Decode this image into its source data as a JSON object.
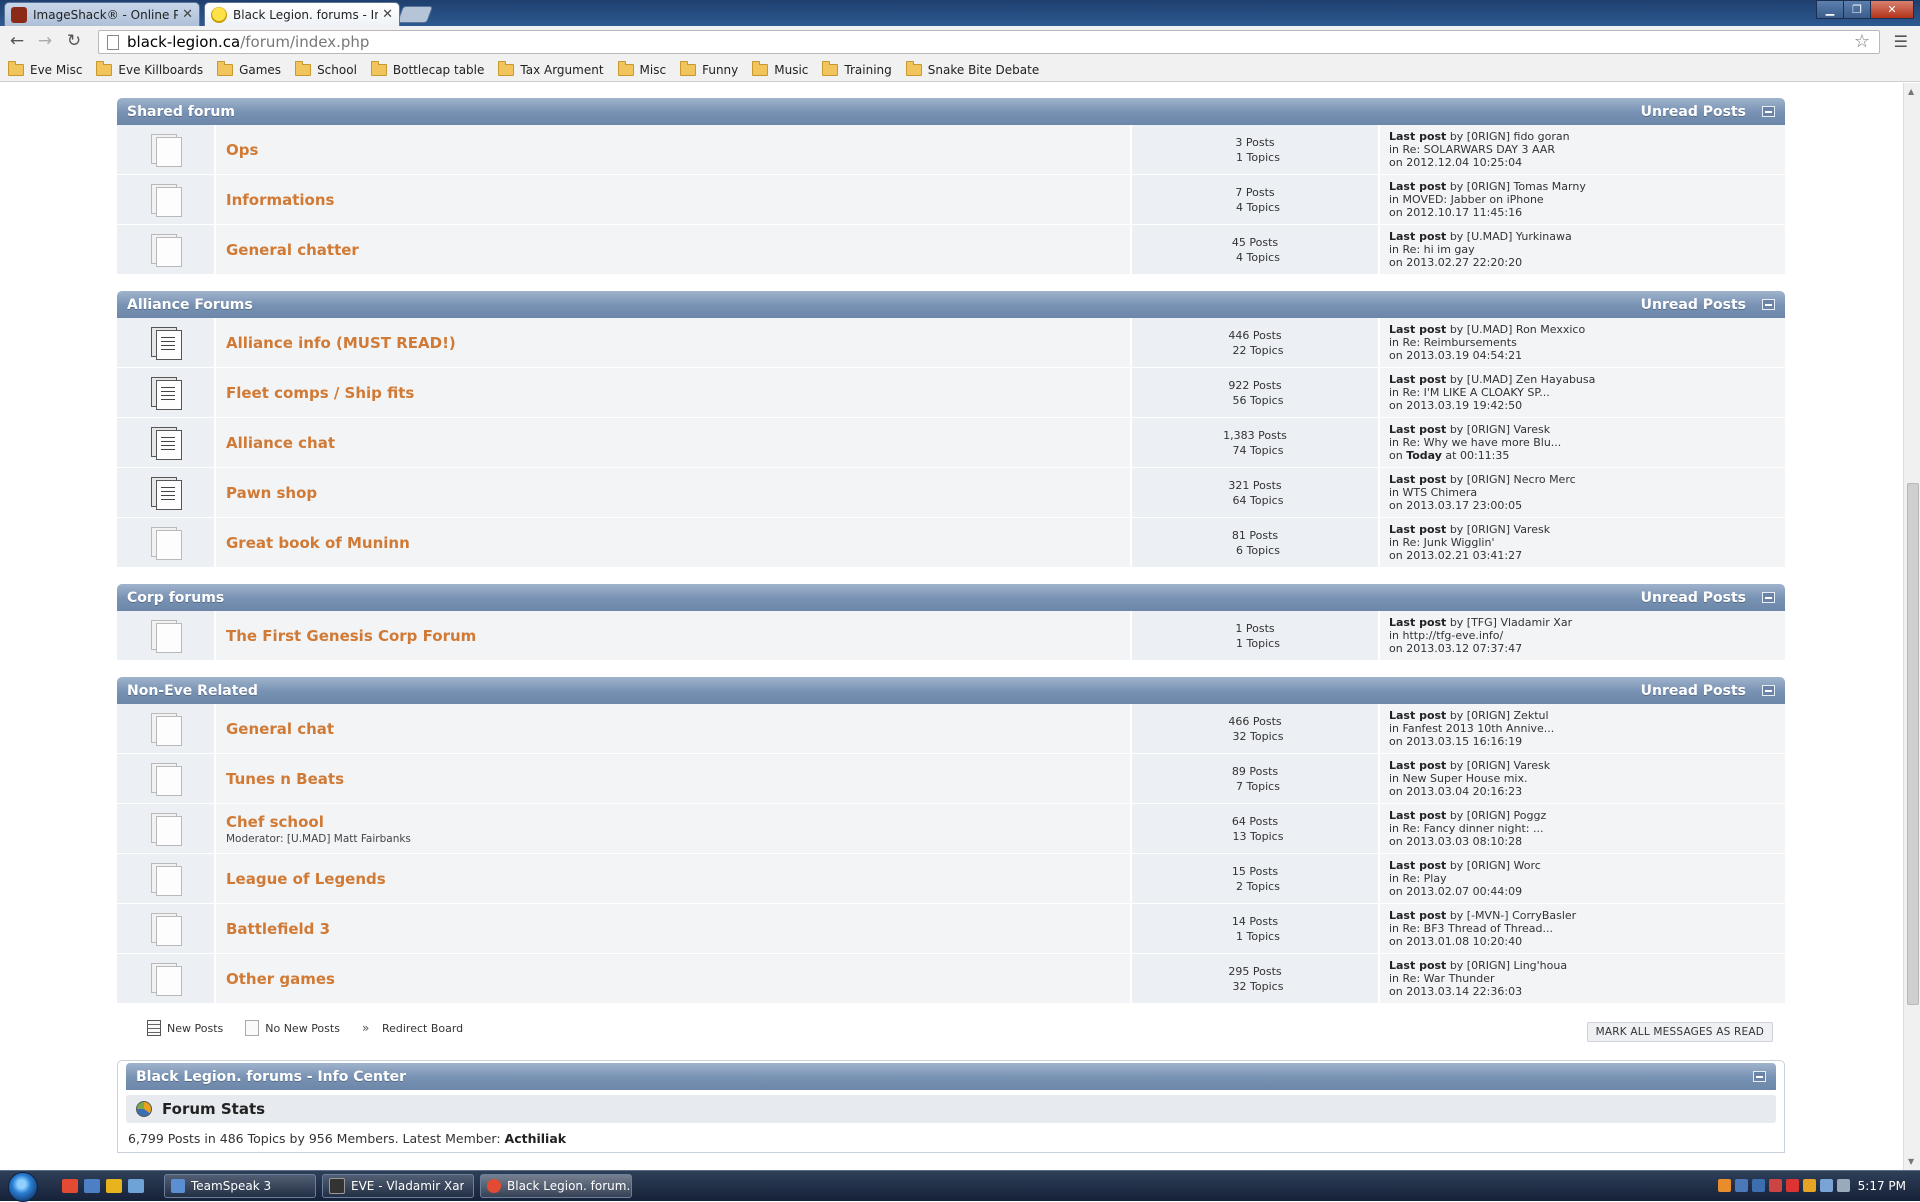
{
  "browser": {
    "tabs": [
      {
        "title": "ImageShack® - Online Ph",
        "favicon": "imageshack-icon"
      },
      {
        "title": "Black Legion. forums - Inc",
        "favicon": "smiley-icon"
      }
    ],
    "url_host": "black-legion.ca",
    "url_path": "/forum/index.php",
    "bookmarks": [
      "Eve Misc",
      "Eve Killboards",
      "Games",
      "School",
      "Bottlecap table",
      "Tax Argument",
      "Misc",
      "Funny",
      "Music",
      "Training",
      "Snake Bite Debate"
    ]
  },
  "forum": {
    "unread_label": "Unread Posts",
    "last_post_label": "Last post",
    "categories": [
      {
        "name": "Shared forum",
        "boards": [
          {
            "name": "Ops",
            "new": false,
            "posts": "3 Posts",
            "topics": "1 Topics",
            "by": "by [0RIGN] fido goran",
            "in": "in Re: SOLARWARS DAY 3 AAR",
            "on": "on 2012.12.04 10:25:04"
          },
          {
            "name": "Informations",
            "new": false,
            "posts": "7 Posts",
            "topics": "4 Topics",
            "by": "by [0RIGN] Tomas Marny",
            "in": "in MOVED: Jabber on iPhone",
            "on": "on 2012.10.17 11:45:16"
          },
          {
            "name": "General chatter",
            "new": false,
            "posts": "45 Posts",
            "topics": "4 Topics",
            "by": "by [U.MAD] Yurkinawa",
            "in": "in Re: hi im gay",
            "on": "on 2013.02.27 22:20:20"
          }
        ]
      },
      {
        "name": "Alliance Forums",
        "boards": [
          {
            "name": "Alliance info (MUST READ!)",
            "new": true,
            "posts": "446 Posts",
            "topics": "22 Topics",
            "by": "by [U.MAD] Ron Mexxico",
            "in": "in Re: Reimbursements",
            "on": "on 2013.03.19 04:54:21"
          },
          {
            "name": "Fleet comps / Ship fits",
            "new": true,
            "posts": "922 Posts",
            "topics": "56 Topics",
            "by": "by [U.MAD] Zen Hayabusa",
            "in": "in Re: I'M LIKE A CLOAKY SP...",
            "on": "on 2013.03.19 19:42:50"
          },
          {
            "name": "Alliance chat",
            "new": true,
            "posts": "1,383 Posts",
            "topics": "74 Topics",
            "by": "by [0RIGN] Varesk",
            "in": "in Re: Why we have more Blu...",
            "on_prefix": "on ",
            "on_bold": "Today",
            "on_suffix": " at 00:11:35"
          },
          {
            "name": "Pawn shop",
            "new": true,
            "posts": "321 Posts",
            "topics": "64 Topics",
            "by": "by [0RIGN] Necro Merc",
            "in": "in WTS Chimera",
            "on": "on 2013.03.17 23:00:05"
          },
          {
            "name": "Great book of Muninn",
            "new": false,
            "posts": "81 Posts",
            "topics": "6 Topics",
            "by": "by [0RIGN] Varesk",
            "in": "in Re: Junk Wigglin'",
            "on": "on 2013.02.21 03:41:27"
          }
        ]
      },
      {
        "name": "Corp forums",
        "boards": [
          {
            "name": "The First Genesis Corp Forum",
            "new": false,
            "posts": "1 Posts",
            "topics": "1 Topics",
            "by": "by [TFG] Vladamir Xar",
            "in": "in http://tfg-eve.info/",
            "on": "on 2013.03.12 07:37:47"
          }
        ]
      },
      {
        "name": "Non-Eve Related",
        "boards": [
          {
            "name": "General chat",
            "new": false,
            "posts": "466 Posts",
            "topics": "32 Topics",
            "by": "by [0RIGN] Zektul",
            "in": "in Fanfest 2013 10th Annive...",
            "on": "on 2013.03.15 16:16:19"
          },
          {
            "name": "Tunes n Beats",
            "new": false,
            "posts": "89 Posts",
            "topics": "7 Topics",
            "by": "by [0RIGN] Varesk",
            "in": "in New Super House mix.",
            "on": "on 2013.03.04 20:16:23"
          },
          {
            "name": "Chef school",
            "new": false,
            "moderator": "Moderator: [U.MAD] Matt Fairbanks",
            "posts": "64 Posts",
            "topics": "13 Topics",
            "by": "by [0RIGN] Poggz",
            "in": "in Re: Fancy dinner night: ...",
            "on": "on 2013.03.03 08:10:28"
          },
          {
            "name": "League of Legends",
            "new": false,
            "posts": "15 Posts",
            "topics": "2 Topics",
            "by": "by [0RIGN] Worc",
            "in": "in Re: Play",
            "on": "on 2013.02.07 00:44:09"
          },
          {
            "name": "Battlefield 3",
            "new": false,
            "posts": "14 Posts",
            "topics": "1 Topics",
            "by": "by [-MVN-] CorryBasler",
            "in": "in Re: BF3 Thread of Thread...",
            "on": "on 2013.01.08 10:20:40"
          },
          {
            "name": "Other games",
            "new": false,
            "posts": "295 Posts",
            "topics": "32 Topics",
            "by": "by [0RIGN] Ling'houa",
            "in": "in Re: War Thunder",
            "on": "on 2013.03.14 22:36:03"
          }
        ]
      }
    ],
    "legend": {
      "new_posts": "New Posts",
      "no_new_posts": "No New Posts",
      "redirect": "Redirect Board"
    },
    "mark_all_label": "MARK ALL MESSAGES AS READ",
    "info_center": {
      "title": "Black Legion. forums - Info Center",
      "stats_title": "Forum Stats",
      "stats_text": "6,799 Posts in 486 Topics by 956 Members. Latest Member: ",
      "latest_member": "Acthiliak"
    }
  },
  "taskbar": {
    "items": [
      "TeamSpeak 3",
      "EVE - Vladamir Xar",
      "Black Legion. forum..."
    ],
    "clock": "5:17 PM"
  }
}
